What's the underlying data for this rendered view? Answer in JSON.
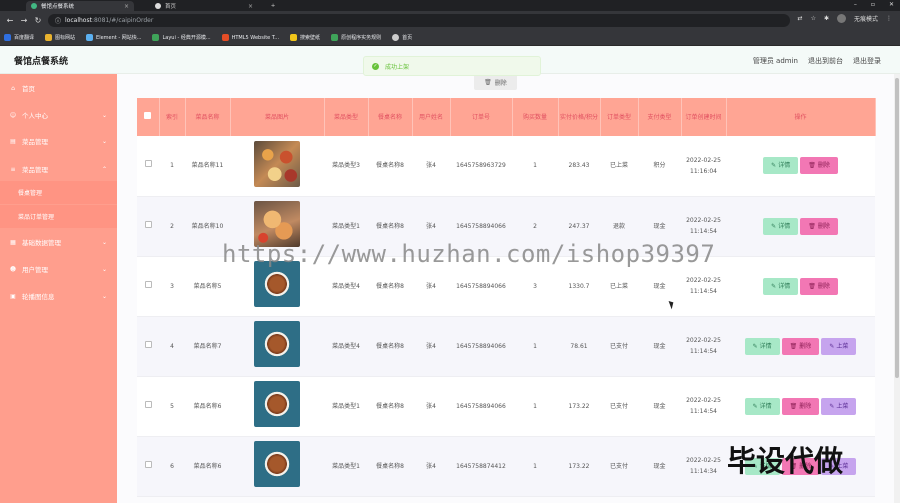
{
  "browser": {
    "tabs": [
      {
        "title": "餐馆点餐系统",
        "active": true
      },
      {
        "title": "首页",
        "active": false
      }
    ],
    "url_host": "localhost",
    "url_path": ":8081/#/caipinOrder",
    "profile_label": "无痕模式",
    "bookmarks": [
      "百度翻译",
      "图标网站",
      "Element - 网站快...",
      "Layui - 经典开源模...",
      "HTML5 Website T...",
      "搜索壁纸",
      "原创程序实务规则",
      "首页"
    ]
  },
  "header": {
    "brand": "餐馆点餐系统",
    "admin_label": "管理员 admin",
    "back_label": "退出到前台",
    "logout_label": "退出登录"
  },
  "toast": {
    "text": "成功上架"
  },
  "top_button": {
    "label": "删除"
  },
  "sidebar": {
    "items": [
      {
        "label": "首页",
        "icon": "home-icon"
      },
      {
        "label": "个人中心",
        "icon": "user-icon"
      },
      {
        "label": "菜品管理",
        "icon": "dish-icon"
      },
      {
        "label": "菜品管理",
        "icon": "order-icon",
        "expanded": true
      },
      {
        "label": "基础数据管理",
        "icon": "data-icon"
      },
      {
        "label": "用户管理",
        "icon": "users-icon"
      },
      {
        "label": "轮播图信息",
        "icon": "image-icon"
      }
    ],
    "subitems": [
      "餐桌管理",
      "菜品订单管理"
    ]
  },
  "table": {
    "headers": [
      "索引",
      "菜品名称",
      "菜品图片",
      "菜品类型",
      "餐桌名称",
      "用户姓名",
      "订单号",
      "购买数量",
      "实付价格/积分",
      "订单类型",
      "支付类型",
      "订单创建时间",
      "操作"
    ],
    "rows": [
      {
        "idx": "1",
        "name": "菜品名称11",
        "img": "food1",
        "type": "菜品类型3",
        "table": "餐桌名称8",
        "user": "张4",
        "order": "1645758963729",
        "qty": "1",
        "price": "283.43",
        "otype": "已上菜",
        "ptype": "积分",
        "time": "2022-02-25 11:16:04",
        "actions": [
          "view",
          "delete"
        ]
      },
      {
        "idx": "2",
        "name": "菜品名称10",
        "img": "food2",
        "type": "菜品类型1",
        "table": "餐桌名称8",
        "user": "张4",
        "order": "1645758894066",
        "qty": "2",
        "price": "247.37",
        "otype": "退款",
        "ptype": "现金",
        "time": "2022-02-25 11:14:54",
        "actions": [
          "view",
          "delete"
        ]
      },
      {
        "idx": "3",
        "name": "菜品名称5",
        "img": "food3",
        "type": "菜品类型4",
        "table": "餐桌名称8",
        "user": "张4",
        "order": "1645758894066",
        "qty": "3",
        "price": "1330.7",
        "otype": "已上菜",
        "ptype": "现金",
        "time": "2022-02-25 11:14:54",
        "actions": [
          "view",
          "delete"
        ]
      },
      {
        "idx": "4",
        "name": "菜品名称7",
        "img": "food3",
        "type": "菜品类型4",
        "table": "餐桌名称8",
        "user": "张4",
        "order": "1645758894066",
        "qty": "1",
        "price": "78.61",
        "otype": "已支付",
        "ptype": "现金",
        "time": "2022-02-25 11:14:54",
        "actions": [
          "view",
          "delete",
          "up"
        ]
      },
      {
        "idx": "5",
        "name": "菜品名称6",
        "img": "food3",
        "type": "菜品类型1",
        "table": "餐桌名称8",
        "user": "张4",
        "order": "1645758894066",
        "qty": "1",
        "price": "173.22",
        "otype": "已支付",
        "ptype": "现金",
        "time": "2022-02-25 11:14:54",
        "actions": [
          "view",
          "delete",
          "up"
        ]
      },
      {
        "idx": "6",
        "name": "菜品名称6",
        "img": "food3",
        "type": "菜品类型1",
        "table": "餐桌名称8",
        "user": "张4",
        "order": "1645758874412",
        "qty": "1",
        "price": "173.22",
        "otype": "已支付",
        "ptype": "现金",
        "time": "2022-02-25 11:14:34",
        "actions": [
          "view",
          "delete",
          "up"
        ]
      }
    ],
    "action_labels": {
      "view": "详情",
      "delete": "删除",
      "up": "上菜"
    }
  },
  "watermark": {
    "url": "https://www.huzhan.com/ishop39397",
    "text": "毕设代做"
  },
  "colors": {
    "sidebar": "#ff9e8d",
    "table_header": "#ffa594",
    "header_text": "#e15060",
    "view_btn": "#a7e8c7",
    "delete_btn": "#f277b4",
    "up_btn": "#c6a4ee"
  }
}
